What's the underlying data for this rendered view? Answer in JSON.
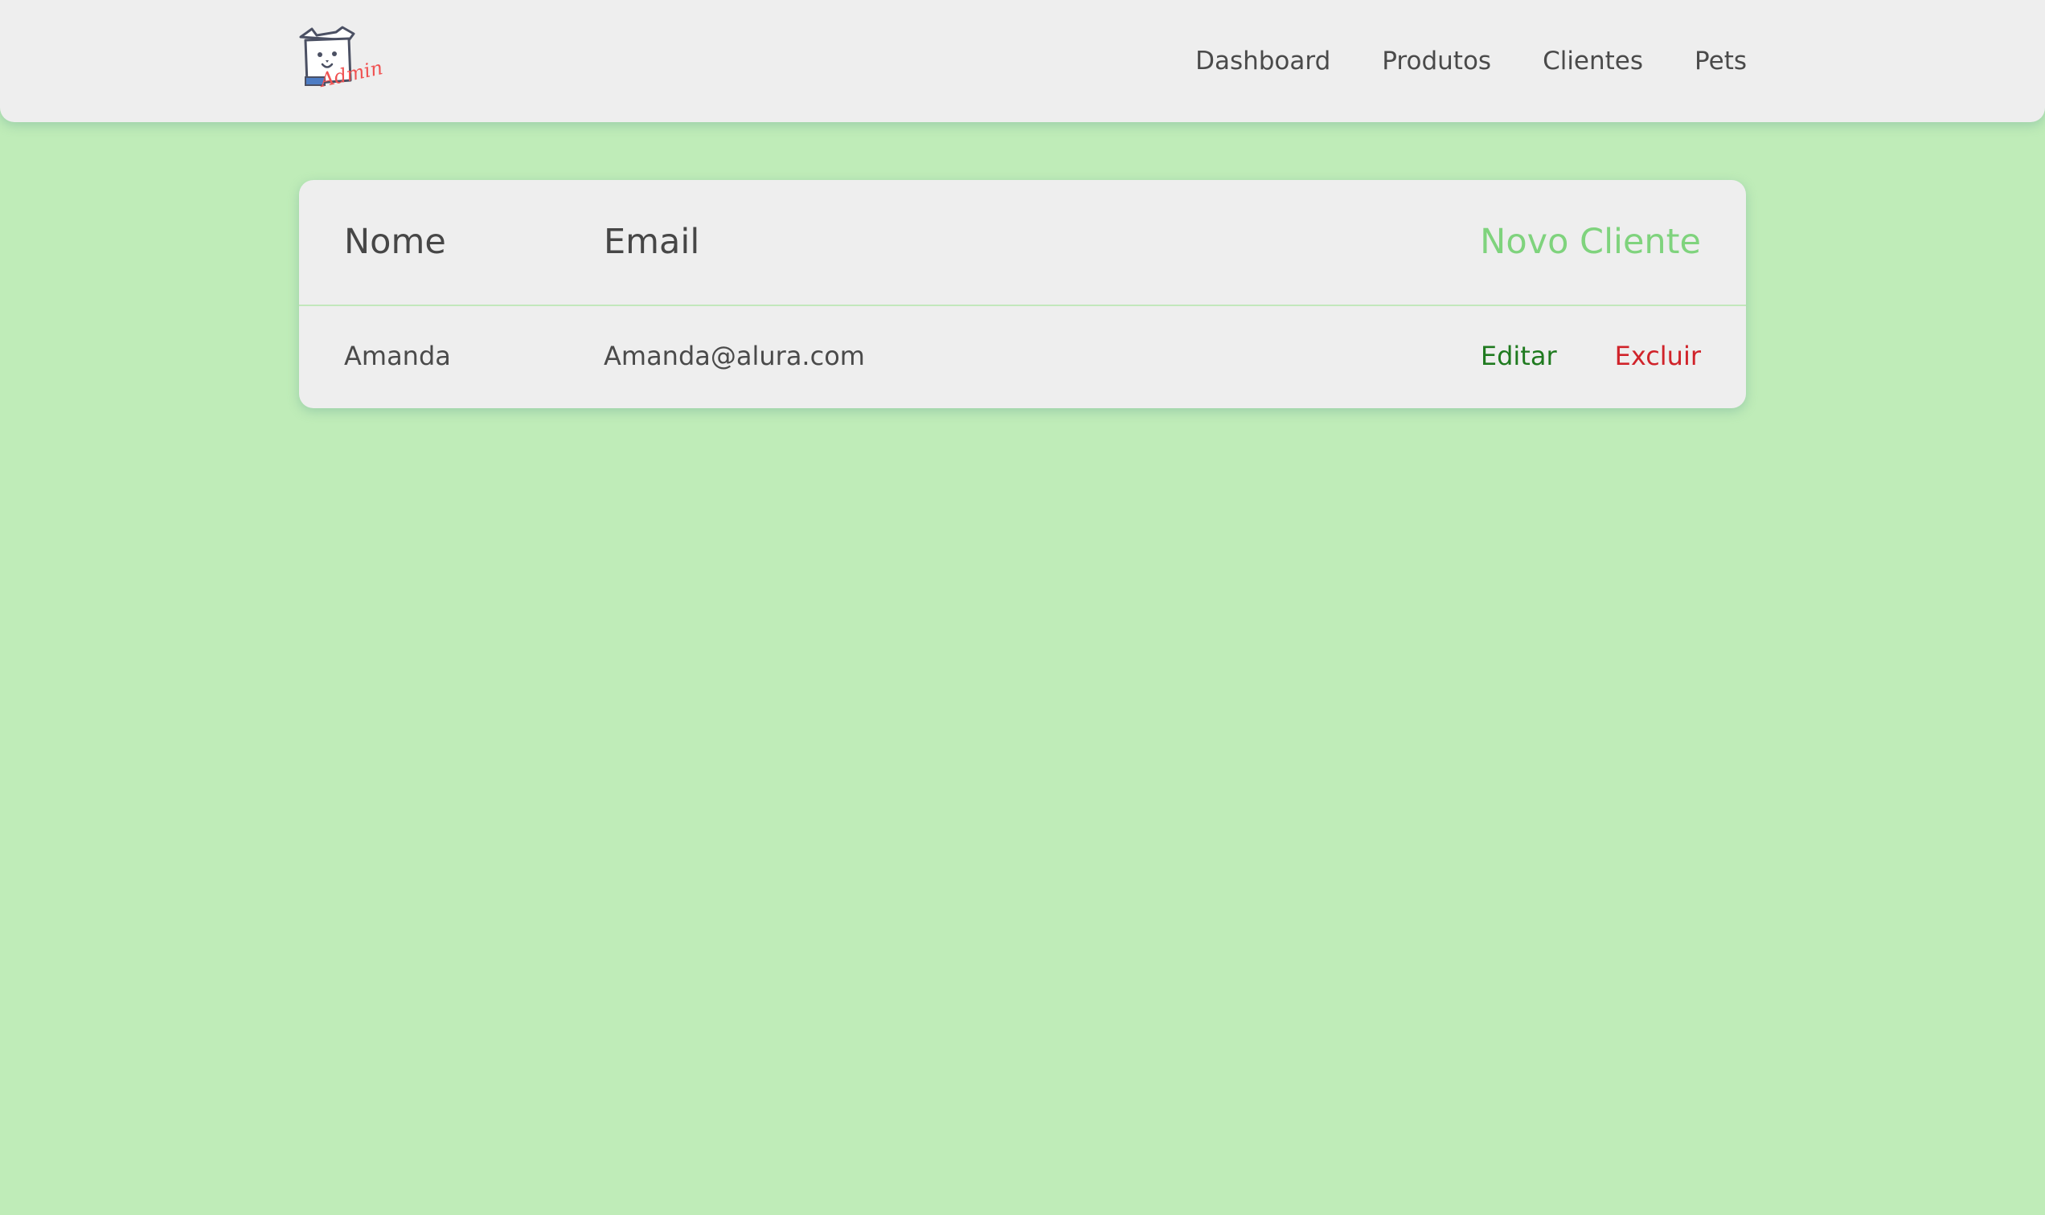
{
  "header": {
    "logo": {
      "icon": "dog-box-icon",
      "text": "Admin",
      "colors": {
        "accent": "#f05252",
        "outline": "#4b5063",
        "collar": "#4d7cc4"
      }
    },
    "nav": [
      {
        "label": "Dashboard"
      },
      {
        "label": "Produtos"
      },
      {
        "label": "Clientes"
      },
      {
        "label": "Pets"
      }
    ]
  },
  "table": {
    "headers": {
      "name": "Nome",
      "email": "Email"
    },
    "new_client_label": "Novo Cliente",
    "rows": [
      {
        "name": "Amanda",
        "email": "Amanda@alura.com",
        "edit_label": "Editar",
        "delete_label": "Excluir"
      }
    ]
  },
  "colors": {
    "background": "#bfecb8",
    "surface": "#eeeeee",
    "new_client": "#7fd37d",
    "edit": "#1f7a1f",
    "delete": "#d0232a"
  }
}
